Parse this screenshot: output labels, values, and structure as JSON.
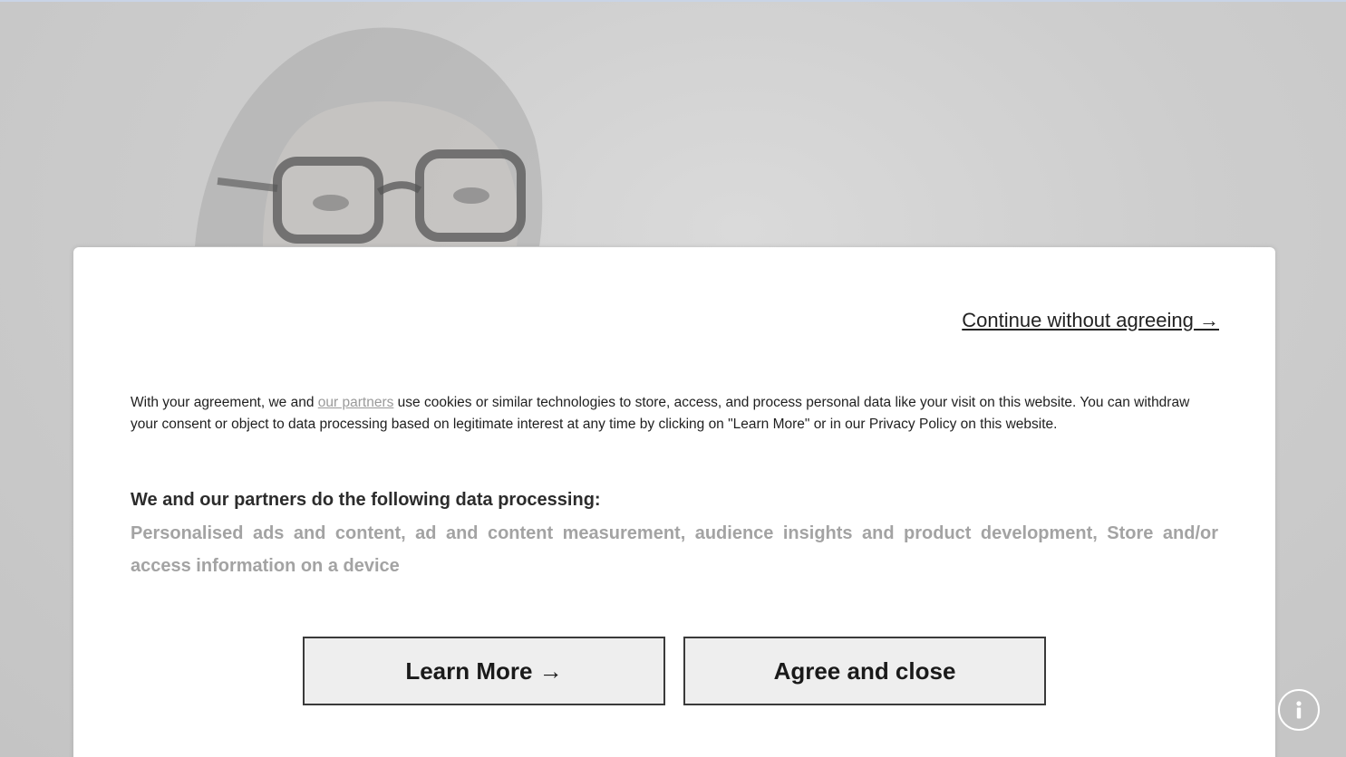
{
  "consent": {
    "continue_link": "Continue without agreeing →",
    "intro": {
      "before_link": "With your agreement, we and ",
      "link_text": "our partners",
      "after_link": " use cookies or similar technologies to store, access, and process personal data like your visit on this website. You can withdraw your consent or object to data processing based on legitimate interest at any time by clicking on \"Learn More\" or in our Privacy Policy on this website."
    },
    "purposes_heading": "We and our partners do the following data processing:",
    "purposes_list": "Personalised ads and content, ad and content measurement, audience insights and product development, Store and/or access information on a device",
    "learn_more_label": "Learn More →",
    "agree_label": "Agree and close"
  },
  "floating": {
    "info_icon": "info-icon"
  },
  "colors": {
    "overlay_bg": "#cfcfcf",
    "modal_bg": "#ffffff",
    "partners_link": "#9a9a9a",
    "purposes_text": "#a3a3a3",
    "button_bg": "#eeeeee",
    "button_border": "#3a3a3a"
  }
}
